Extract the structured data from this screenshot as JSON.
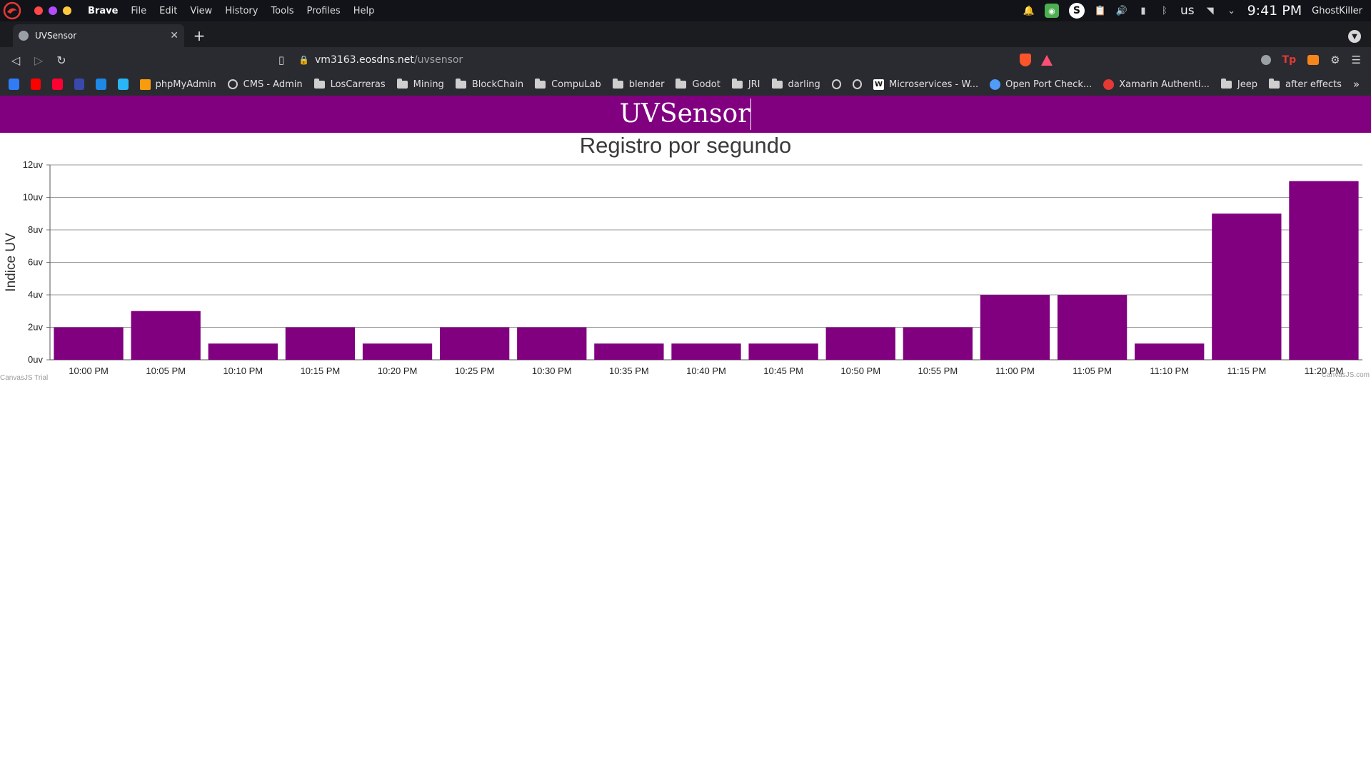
{
  "os": {
    "app_name": "Brave",
    "menu": [
      "File",
      "Edit",
      "View",
      "History",
      "Tools",
      "Profiles",
      "Help"
    ],
    "lang": "us",
    "clock": "9:41 PM",
    "user": "GhostKiller",
    "window_dot_colors": [
      "#ff4747",
      "#b44bff",
      "#ffc93d"
    ]
  },
  "browser": {
    "tab_title": "UVSensor",
    "new_tab": "+",
    "url_host": "vm3163.eosdns.net",
    "url_path": "/uvsensor",
    "bookmarks": [
      {
        "type": "icon",
        "icon": "arrow-a-icon",
        "color": "#2f7cf6"
      },
      {
        "type": "icon",
        "icon": "youtube-icon",
        "color": "#ff0000"
      },
      {
        "type": "icon",
        "icon": "youtube-music-icon",
        "color": "#ff0033"
      },
      {
        "type": "icon",
        "icon": "chart-app-icon",
        "color": "#3949ab"
      },
      {
        "type": "icon",
        "icon": "azure-icon",
        "color": "#1e88e5"
      },
      {
        "type": "icon",
        "icon": "box-icon",
        "color": "#29b6f6"
      },
      {
        "type": "label",
        "label": "phpMyAdmin",
        "icon": "phpmyadmin-icon"
      },
      {
        "type": "label",
        "label": "CMS - Admin",
        "icon": "globe-icon"
      },
      {
        "type": "label",
        "label": "LosCarreras",
        "icon": "folder-icon"
      },
      {
        "type": "label",
        "label": "Mining",
        "icon": "folder-icon"
      },
      {
        "type": "label",
        "label": "BlockChain",
        "icon": "folder-icon"
      },
      {
        "type": "label",
        "label": "CompuLab",
        "icon": "folder-icon"
      },
      {
        "type": "label",
        "label": "blender",
        "icon": "folder-icon"
      },
      {
        "type": "label",
        "label": "Godot",
        "icon": "folder-icon"
      },
      {
        "type": "label",
        "label": "JRI",
        "icon": "folder-icon"
      },
      {
        "type": "label",
        "label": "darling",
        "icon": "folder-icon"
      },
      {
        "type": "icon",
        "icon": "globe-icon",
        "color": "#cfcfcf"
      },
      {
        "type": "icon",
        "icon": "globe-icon",
        "color": "#cfcfcf"
      },
      {
        "type": "label",
        "label": "Microservices - W...",
        "icon": "wikipedia-icon"
      },
      {
        "type": "label",
        "label": "Open Port Check...",
        "icon": "globe-blue-icon"
      },
      {
        "type": "label",
        "label": "Xamarin Authenti...",
        "icon": "xamarin-icon"
      },
      {
        "type": "label",
        "label": "Jeep",
        "icon": "folder-icon"
      },
      {
        "type": "label",
        "label": "after effects",
        "icon": "folder-icon"
      }
    ],
    "bookmarks_more": "»"
  },
  "page": {
    "header_title": "UVSensor",
    "brand_color": "#800080"
  },
  "chart_data": {
    "type": "bar",
    "title": "Registro por segundo",
    "ylabel": "Indice UV",
    "xlabel": "",
    "y_suffix": "uv",
    "ylim": [
      0,
      12
    ],
    "y_ticks": [
      0,
      2,
      4,
      6,
      8,
      10,
      12
    ],
    "categories": [
      "10:00 PM",
      "10:05 PM",
      "10:10 PM",
      "10:15 PM",
      "10:20 PM",
      "10:25 PM",
      "10:30 PM",
      "10:35 PM",
      "10:40 PM",
      "10:45 PM",
      "10:50 PM",
      "10:55 PM",
      "11:00 PM",
      "11:05 PM",
      "11:10 PM",
      "11:15 PM",
      "11:20 PM"
    ],
    "values": [
      2,
      3,
      1,
      2,
      1,
      2,
      2,
      1,
      1,
      1,
      2,
      2,
      4,
      4,
      1,
      9,
      11
    ],
    "bar_color": "#800080",
    "grid": true,
    "credit_left": "CanvasJS Trial",
    "credit_right": "CanvasJS.com"
  }
}
